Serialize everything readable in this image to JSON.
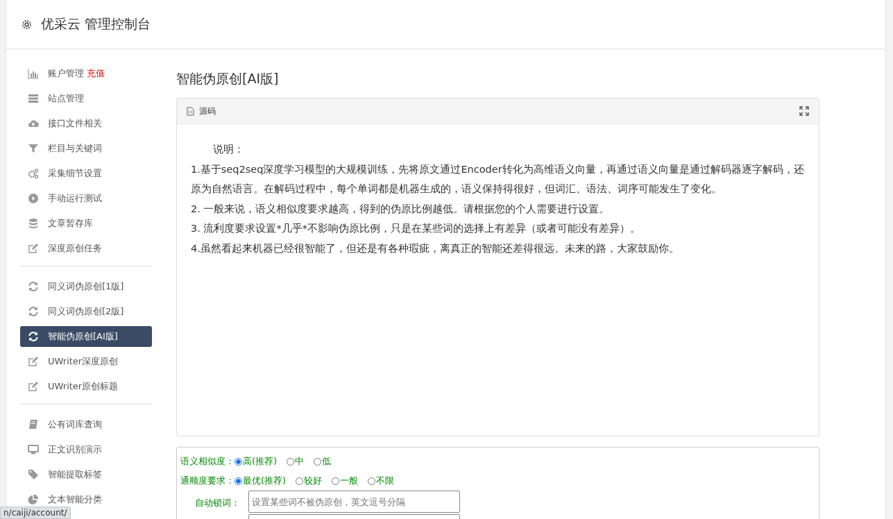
{
  "header": {
    "title": "优采云 管理控制台"
  },
  "sidebar": {
    "groups": [
      {
        "items": [
          {
            "label": "账户管理",
            "badge": "充值",
            "selected": false
          },
          {
            "label": "站点管理",
            "selected": false
          },
          {
            "label": "接口文件相关",
            "selected": false
          },
          {
            "label": "栏目与关键词",
            "selected": false
          },
          {
            "label": "采集细节设置",
            "selected": false
          },
          {
            "label": "手动运行测试",
            "selected": false
          },
          {
            "label": "文章暂存库",
            "selected": false
          },
          {
            "label": "深度原创任务",
            "selected": false
          }
        ]
      },
      {
        "items": [
          {
            "label": "同义词伪原创[1版]",
            "selected": false
          },
          {
            "label": "同义词伪原创[2版]",
            "selected": false
          },
          {
            "label": "智能伪原创[AI版]",
            "selected": true
          },
          {
            "label": "UWriter深度原创",
            "selected": false
          },
          {
            "label": "UWriter原创标题",
            "selected": false
          }
        ]
      },
      {
        "items": [
          {
            "label": "公有词库查询",
            "selected": false
          },
          {
            "label": "正文识别演示",
            "selected": false
          },
          {
            "label": "智能提取标签",
            "selected": false
          },
          {
            "label": "文本智能分类",
            "selected": false
          }
        ]
      }
    ]
  },
  "page_title": "智能伪原创[AI版]",
  "editor": {
    "tab": "源码",
    "lines": [
      "说明：",
      "1.基于seq2seq深度学习模型的大规模训练，先将原文通过Encoder转化为高维语义向量，再通过语义向量是通过解码器逐字解码，还原为自然语言。在解码过程中，每个单词都是机器生成的，语义保持得很好，但词汇、语法、词序可能发生了变化。",
      "2. 一般来说，语义相似度要求越高，得到的伪原比例越低。请根据您的个人需要进行设置。",
      "3. 流利度要求设置*几乎*不影响伪原比例，只是在某些词的选择上有差异（或者可能没有差异）。",
      "4.虽然看起来机器已经很智能了，但还是有各种瑕疵，离真正的智能还差得很远。未来的路，大家鼓励你。"
    ]
  },
  "form": {
    "radio_groups": [
      {
        "label": "语义相似度：",
        "options": [
          {
            "label": "高(推荐)",
            "selected": true
          },
          {
            "label": "中",
            "selected": false
          },
          {
            "label": "低",
            "selected": false
          }
        ]
      },
      {
        "label": "通顺度要求：",
        "options": [
          {
            "label": "最优(推荐)",
            "selected": true
          },
          {
            "label": "较好",
            "selected": false
          },
          {
            "label": "一般",
            "selected": false
          },
          {
            "label": "不限",
            "selected": false
          }
        ]
      }
    ],
    "lock_words": {
      "label": "自动锁词：",
      "placeholder": "设置某些词不被伪原创，英文逗号分隔"
    }
  },
  "status_bar": {
    "url": "n/caiji/account/"
  }
}
